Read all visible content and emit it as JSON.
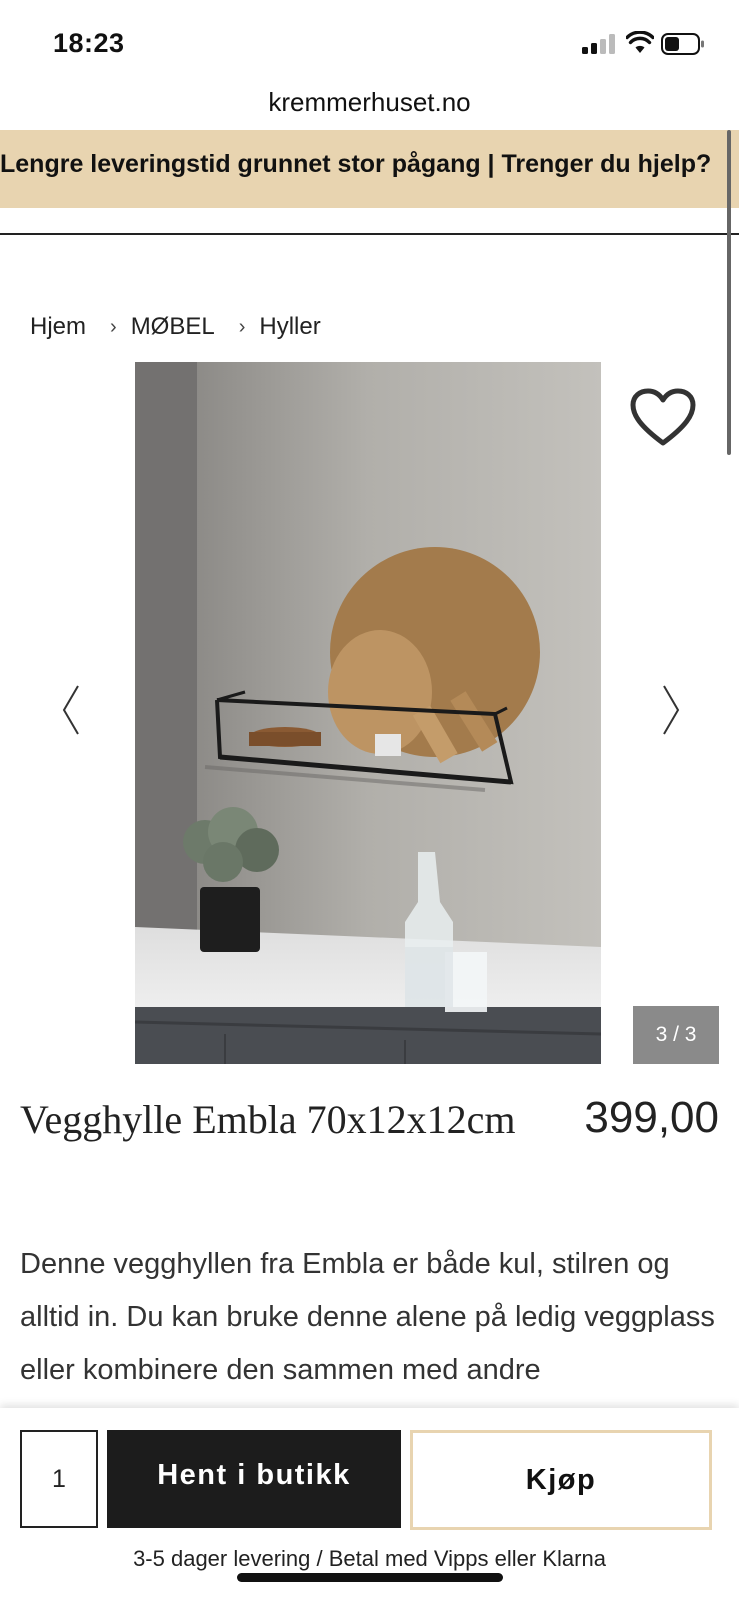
{
  "status_bar": {
    "time": "18:23",
    "signal_icon": "signal-bars-icon",
    "wifi_icon": "wifi-icon",
    "battery_icon": "battery-icon"
  },
  "browser": {
    "url": "kremmerhuset.no"
  },
  "banner": {
    "text": "Lengre leveringstid grunnet stor pågang | Trenger du hjelp?",
    "background": "#e8d4b0"
  },
  "breadcrumb": {
    "items": [
      "Hjem",
      "MØBEL",
      "Hyller"
    ]
  },
  "gallery": {
    "counter": "3 / 3",
    "prev_icon": "chevron-left-icon",
    "next_icon": "chevron-right-icon",
    "favorite_icon": "heart-outline-icon"
  },
  "product": {
    "title": "Vegghylle Embla 70x12x12cm",
    "price": "399,00",
    "description": "Denne vegghyllen fra Embla er både kul, stilren og alltid in. Du kan bruke denne alene på ledig veggplass eller kombinere den sammen med andre"
  },
  "purchase": {
    "quantity": "1",
    "pickup_label": "Hent i butikk",
    "buy_label": "Kjøp",
    "delivery_info": "3-5 dager levering / Betal med Vipps eller Klarna"
  },
  "colors": {
    "accent": "#e8d4b0",
    "dark_button": "#1c1c1c"
  }
}
